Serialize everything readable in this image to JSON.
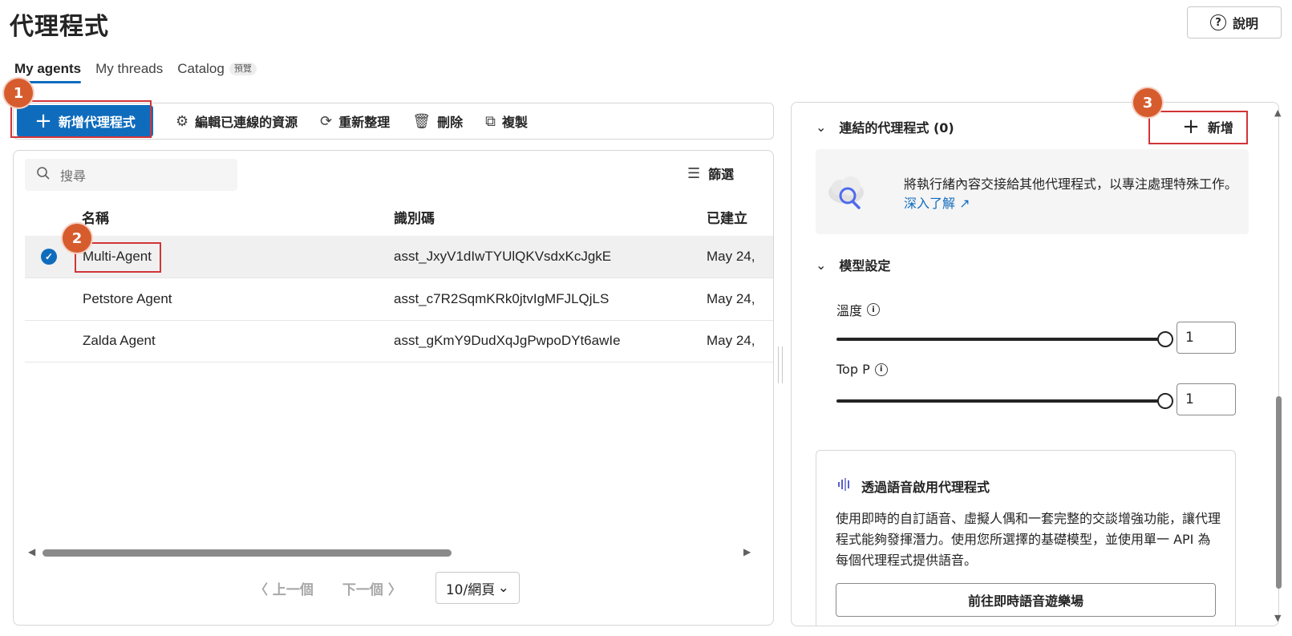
{
  "page": {
    "title": "代理程式",
    "help_label": "說明"
  },
  "tabs": [
    {
      "label": "My agents"
    },
    {
      "label": "My threads"
    },
    {
      "label": "Catalog",
      "badge": "預覽"
    }
  ],
  "toolbar": {
    "new_agent": "新增代理程式",
    "edit_resources": "編輯已連線的資源",
    "refresh": "重新整理",
    "delete": "刪除",
    "copy": "複製"
  },
  "list": {
    "search_placeholder": "搜尋",
    "filter_label": "篩選",
    "columns": [
      "名稱",
      "識別碼",
      "已建立"
    ],
    "rows": [
      {
        "name": "Multi-Agent",
        "id": "asst_JxyV1dIwTYUlQKVsdxKcJgkE",
        "created": "May 24,",
        "selected": true
      },
      {
        "name": "Petstore Agent",
        "id": "asst_c7R2SqmKRk0jtvIgMFJLQjLS",
        "created": "May 24,",
        "selected": false
      },
      {
        "name": "Zalda Agent",
        "id": "asst_gKmY9DudXqJgPwpoDYt6awIe",
        "created": "May 24,",
        "selected": false
      }
    ]
  },
  "pager": {
    "prev": "上一個",
    "next": "下一個",
    "page_size": "10/網頁"
  },
  "steps": [
    "1",
    "2",
    "3"
  ],
  "right": {
    "connected_agents": "連結的代理程式 (0)",
    "add_label": "新增",
    "info_text": "將執行緒內容交接給其他代理程式，以專注處理特殊工作。",
    "learn_more": "深入了解",
    "model_settings": "模型設定",
    "temperature_label": "溫度",
    "temperature_value": "1",
    "top_p_label": "Top P",
    "top_p_value": "1",
    "voice_title": "透過語音啟用代理程式",
    "voice_body": "使用即時的自訂語音、虛擬人偶和一套完整的交談增強功能，讓代理程式能夠發揮潛力。使用您所選擇的基礎模型，並使用單一 API 為每個代理程式提供語音。",
    "voice_button": "前往即時語音遊樂場"
  },
  "colors": {
    "accent": "#0f6cbd",
    "highlight": "#d13438",
    "step_badge": "#d65c2e"
  }
}
